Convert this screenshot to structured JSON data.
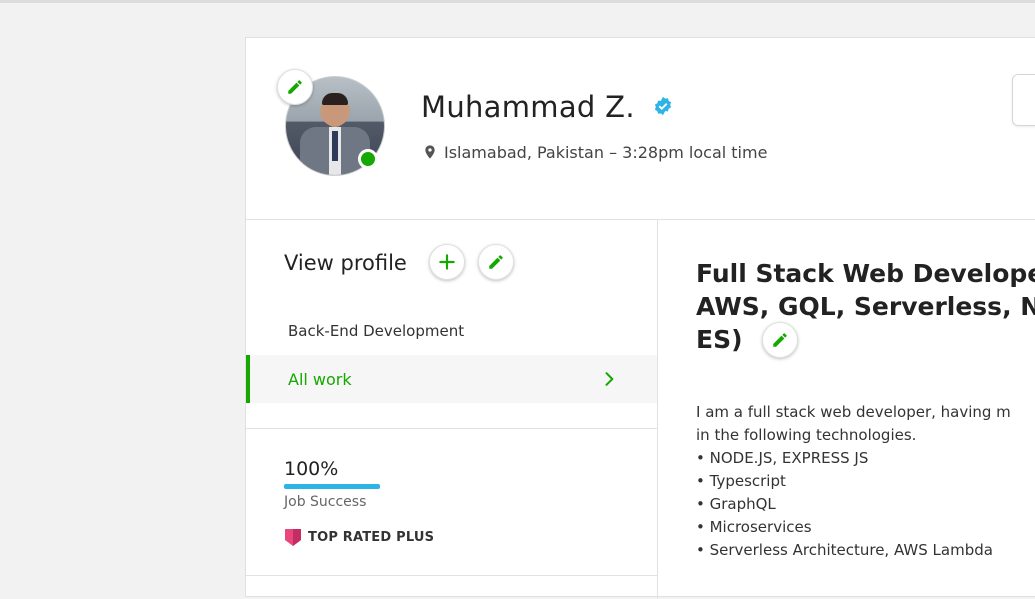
{
  "profile": {
    "name": "Muhammad Z.",
    "location": "Islamabad, Pakistan – 3:28pm local time",
    "online": true
  },
  "left": {
    "view_profile": "View profile",
    "nav": {
      "backend": "Back-End Development",
      "all_work": "All work"
    },
    "job_success": {
      "value": "100%",
      "percent": 100,
      "label": "Job Success"
    },
    "badge": "TOP RATED PLUS"
  },
  "right": {
    "title_lines": [
      "Full Stack Web Develope",
      "AWS, GQL, Serverless, N",
      "ES)"
    ],
    "description_lines": [
      "I am a full stack web developer, having m",
      "in the following technologies.",
      "• NODE.JS, EXPRESS JS",
      "• Typescript",
      "• GraphQL",
      "• Microservices",
      "• Serverless Architecture, AWS Lambda"
    ]
  },
  "colors": {
    "accent": "#14a800",
    "verified": "#2eb3e6",
    "job_success_bar": "#2eb3e6",
    "badge": "#e8467c"
  },
  "icons": {
    "edit": "pencil-icon",
    "add": "plus-icon",
    "verified": "verified-badge-icon",
    "location": "map-pin-icon",
    "chevron": "chevron-right-icon",
    "badge": "top-rated-plus-badge-icon"
  }
}
